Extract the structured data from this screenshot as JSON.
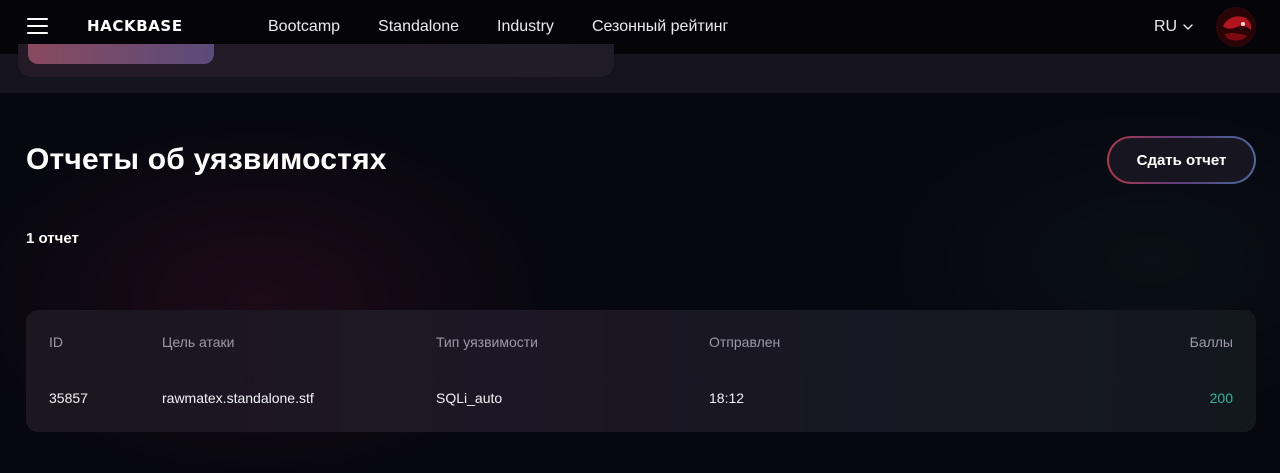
{
  "header": {
    "logo": "HACKBASE",
    "nav": [
      "Bootcamp",
      "Standalone",
      "Industry",
      "Сезонный рейтинг"
    ],
    "language": "RU"
  },
  "main": {
    "title": "Отчеты об уязвимостях",
    "submit_label": "Сдать отчет",
    "count_label": "1 отчет"
  },
  "table": {
    "columns": [
      "ID",
      "Цель атаки",
      "Тип уязвимости",
      "Отправлен",
      "Баллы"
    ],
    "rows": [
      [
        "35857",
        "rawmatex.standalone.stf",
        "SQLi_auto",
        "18:12",
        "200"
      ]
    ]
  },
  "colors": {
    "background": "#07070f",
    "points": "#2fb59a",
    "button_gradient_start": "#b0364e",
    "button_gradient_end": "#4a6a9a"
  },
  "icons": [
    "menu-icon",
    "chevron-down-icon",
    "avatar"
  ]
}
